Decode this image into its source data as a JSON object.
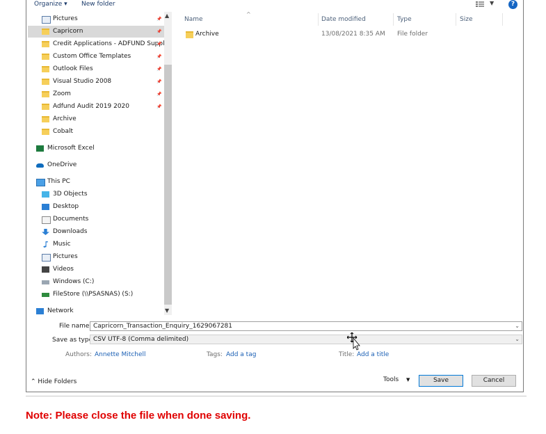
{
  "toolbar": {
    "organize": "Organize ▾",
    "new_folder": "New folder",
    "help": "?"
  },
  "nav": {
    "items": [
      {
        "label": "Pictures",
        "icon": "pictures-icon",
        "pinned": true
      },
      {
        "label": "Capricorn",
        "icon": "folder-icon",
        "pinned": true,
        "selected": true
      },
      {
        "label": "Credit Applications - ADFUND Supplie",
        "icon": "folder-icon",
        "pinned": true
      },
      {
        "label": "Custom Office Templates",
        "icon": "folder-icon",
        "pinned": true
      },
      {
        "label": "Outlook Files",
        "icon": "folder-icon",
        "pinned": true
      },
      {
        "label": "Visual Studio 2008",
        "icon": "folder-icon",
        "pinned": true
      },
      {
        "label": "Zoom",
        "icon": "folder-icon",
        "pinned": true
      },
      {
        "label": "Adfund Audit 2019 2020",
        "icon": "folder-icon",
        "pinned": true
      },
      {
        "label": "Archive",
        "icon": "folder-icon",
        "pinned": false
      },
      {
        "label": "Cobalt",
        "icon": "folder-icon",
        "pinned": false
      },
      {
        "label": "Microsoft Excel",
        "icon": "excel-icon",
        "pinned": false
      },
      {
        "label": "OneDrive",
        "icon": "onedrive-icon",
        "pinned": false
      },
      {
        "label": "This PC",
        "icon": "this-pc-icon",
        "pinned": false
      },
      {
        "label": "3D Objects",
        "icon": "3d-objects-icon",
        "pinned": false
      },
      {
        "label": "Desktop",
        "icon": "desktop-icon",
        "pinned": false
      },
      {
        "label": "Documents",
        "icon": "documents-icon",
        "pinned": false
      },
      {
        "label": "Downloads",
        "icon": "downloads-icon",
        "pinned": false
      },
      {
        "label": "Music",
        "icon": "music-icon",
        "pinned": false
      },
      {
        "label": "Pictures",
        "icon": "pictures-icon",
        "pinned": false
      },
      {
        "label": "Videos",
        "icon": "videos-icon",
        "pinned": false
      },
      {
        "label": "Windows (C:)",
        "icon": "drive-icon",
        "pinned": false
      },
      {
        "label": "FileStore (\\\\PSASNAS) (S:)",
        "icon": "network-drive-icon",
        "pinned": false
      },
      {
        "label": "Network",
        "icon": "network-icon",
        "pinned": false
      }
    ]
  },
  "columns": {
    "name": "Name",
    "date_modified": "Date modified",
    "type": "Type",
    "size": "Size"
  },
  "files": [
    {
      "name": "Archive",
      "date_modified": "13/08/2021 8:35 AM",
      "type": "File folder",
      "size": ""
    }
  ],
  "form": {
    "file_name_label": "File name:",
    "file_name_value": "Capricorn_Transaction_Enquiry_1629067281",
    "save_type_label": "Save as type:",
    "save_type_value": "CSV UTF-8 (Comma delimited)",
    "authors_label": "Authors:",
    "authors_value": "Annette Mitchell",
    "tags_label": "Tags:",
    "tags_value": "Add a tag",
    "title_label": "Title:",
    "title_value": "Add a title"
  },
  "footer": {
    "hide_folders": "Hide Folders",
    "tools": "Tools",
    "save": "Save",
    "cancel": "Cancel"
  },
  "note": "Note: Please close the file when done saving.",
  "colors": {
    "accent": "#1566c4",
    "link": "#1a5fb4",
    "note": "#e00000",
    "selected": "#d9d9d9"
  }
}
